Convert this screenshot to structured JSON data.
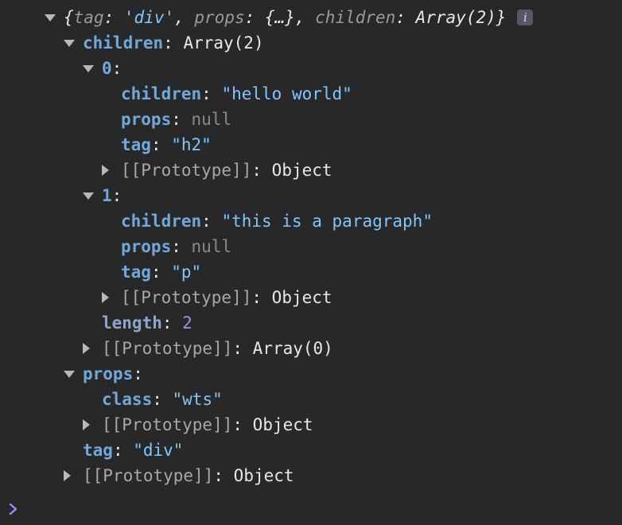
{
  "summary": {
    "open": "{",
    "k1": "tag",
    "sep1": ": ",
    "v1": "'div'",
    "c1": ", ",
    "k2": "props",
    "sep2": ": ",
    "v2": "{…}",
    "c2": ", ",
    "k3": "children",
    "sep3": ": ",
    "v3": "Array(2)",
    "close": "}",
    "info_icon": "i"
  },
  "children": {
    "key": "children",
    "sep": ": ",
    "value": "Array(2)",
    "item0": {
      "key": "0",
      "sep": ":",
      "children_key": "children",
      "children_val": "\"hello world\"",
      "props_key": "props",
      "props_val": "null",
      "tag_key": "tag",
      "tag_val": "\"h2\"",
      "proto_key": "[[Prototype]]",
      "proto_val": "Object"
    },
    "item1": {
      "key": "1",
      "sep": ":",
      "children_key": "children",
      "children_val": "\"this is a paragraph\"",
      "props_key": "props",
      "props_val": "null",
      "tag_key": "tag",
      "tag_val": "\"p\"",
      "proto_key": "[[Prototype]]",
      "proto_val": "Object"
    },
    "length_key": "length",
    "length_val": "2",
    "proto_key": "[[Prototype]]",
    "proto_val": "Array(0)"
  },
  "props": {
    "key": "props",
    "sep": ":",
    "class_key": "class",
    "class_val": "\"wts\"",
    "proto_key": "[[Prototype]]",
    "proto_val": "Object"
  },
  "tag": {
    "key": "tag",
    "val": "\"div\""
  },
  "root_proto": {
    "key": "[[Prototype]]",
    "val": "Object"
  },
  "colors": {
    "background": "#282828",
    "key": "#6fa8dc",
    "string": "#7ec7ff",
    "null": "#8a8a8a",
    "number": "#a88bfa",
    "prompt": "#a88bfa"
  },
  "prompt_icon": "chevron-right-icon"
}
